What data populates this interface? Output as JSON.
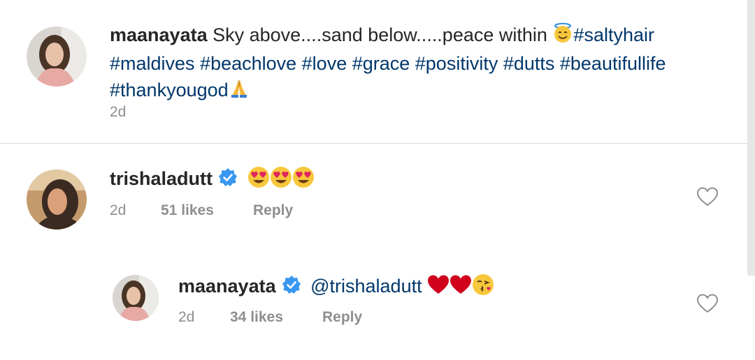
{
  "caption": {
    "username": "maanayata",
    "text": "Sky above....sand below.....peace within",
    "hashtag_line1": "#saltyhair",
    "hashtags_line2": "#maldives #beachlove #love #grace #positivity #dutts #beautifullife",
    "hashtag_line3": "#thankyougod",
    "time": "2d"
  },
  "comments": [
    {
      "username": "trishaladutt",
      "verified": true,
      "emojis": [
        "heart-eyes",
        "heart-eyes",
        "heart-eyes"
      ],
      "time": "2d",
      "likes": "51 likes",
      "reply_label": "Reply"
    },
    {
      "username": "maanayata",
      "verified": true,
      "mention": "@trishaladutt",
      "emojis": [
        "red-heart",
        "red-heart",
        "kiss-face"
      ],
      "time": "2d",
      "likes": "34 likes",
      "reply_label": "Reply"
    }
  ],
  "colors": {
    "hashtag": "#00376b",
    "meta": "#8e8e8e",
    "verified": "#3897f0",
    "divider": "#dbdbdb"
  }
}
